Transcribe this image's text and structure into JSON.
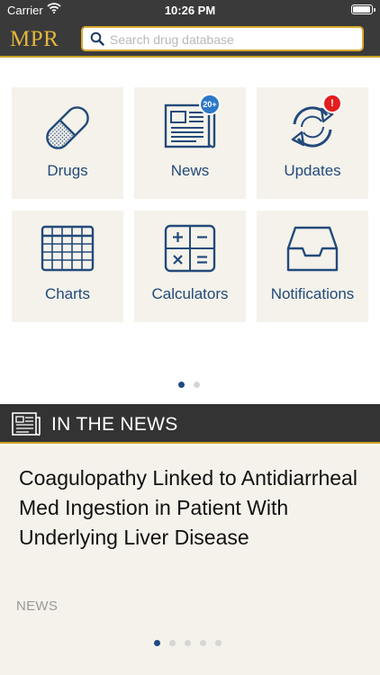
{
  "status_bar": {
    "carrier": "Carrier",
    "time": "10:26 PM"
  },
  "header": {
    "logo": "MPR",
    "search_placeholder": "Search drug database"
  },
  "tiles": [
    {
      "label": "Drugs",
      "icon": "pill-icon"
    },
    {
      "label": "News",
      "icon": "newspaper-icon",
      "badge": "20+"
    },
    {
      "label": "Updates",
      "icon": "refresh-icon",
      "badge": "!"
    },
    {
      "label": "Charts",
      "icon": "table-chart-icon"
    },
    {
      "label": "Calculators",
      "icon": "calculator-icon"
    },
    {
      "label": "Notifications",
      "icon": "inbox-tray-icon"
    }
  ],
  "grid_pager": {
    "pages": 2,
    "current": 1
  },
  "news_section": {
    "title": "IN THE NEWS",
    "headline": "Coagulopathy Linked to Antidiarrheal Med Ingestion in Patient With Underlying Liver Disease",
    "category": "NEWS",
    "pages": 5,
    "current": 1
  },
  "colors": {
    "header_bg": "#3a3a3a",
    "accent_gold": "#c9a227",
    "tile_bg": "#f4f2ea",
    "icon_blue": "#234a7b",
    "badge_blue": "#2c78c6",
    "badge_red": "#e41e1e"
  }
}
